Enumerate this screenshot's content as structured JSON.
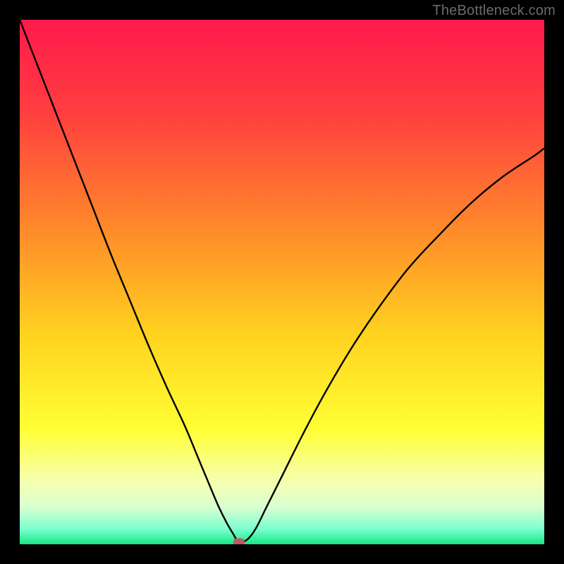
{
  "watermark": "TheBottleneck.com",
  "chart_data": {
    "type": "line",
    "title": "",
    "xlabel": "",
    "ylabel": "",
    "xlim": [
      0,
      100
    ],
    "ylim": [
      0,
      100
    ],
    "gradient_stops": [
      {
        "offset": 0.0,
        "color": "#ff1a4b"
      },
      {
        "offset": 0.18,
        "color": "#ff3f3f"
      },
      {
        "offset": 0.4,
        "color": "#ff8a2a"
      },
      {
        "offset": 0.6,
        "color": "#ffd21f"
      },
      {
        "offset": 0.78,
        "color": "#ffff33"
      },
      {
        "offset": 0.88,
        "color": "#f6ffb0"
      },
      {
        "offset": 0.93,
        "color": "#d8ffd0"
      },
      {
        "offset": 0.97,
        "color": "#7dffcf"
      },
      {
        "offset": 1.0,
        "color": "#17e884"
      }
    ],
    "series": [
      {
        "name": "bottleneck-curve",
        "x": [
          0.0,
          3.5,
          7.0,
          10.5,
          14.0,
          17.5,
          21.0,
          24.5,
          28.0,
          31.5,
          34.0,
          36.5,
          38.0,
          39.5,
          40.8,
          41.6,
          42.3,
          43.5,
          45.0,
          47.0,
          50.0,
          54.0,
          58.0,
          63.0,
          68.0,
          74.0,
          80.0,
          86.0,
          92.0,
          98.0,
          100.0
        ],
        "y": [
          100.0,
          91.0,
          82.0,
          73.0,
          64.0,
          55.0,
          46.5,
          38.0,
          30.0,
          22.5,
          16.5,
          10.5,
          7.0,
          4.0,
          1.8,
          0.4,
          0.4,
          1.0,
          3.0,
          7.0,
          13.0,
          21.0,
          28.5,
          37.0,
          44.5,
          52.5,
          59.0,
          65.0,
          70.0,
          74.0,
          75.5
        ]
      }
    ],
    "marker": {
      "x": 41.8,
      "y": 0.4,
      "color": "#c05a5a"
    }
  }
}
